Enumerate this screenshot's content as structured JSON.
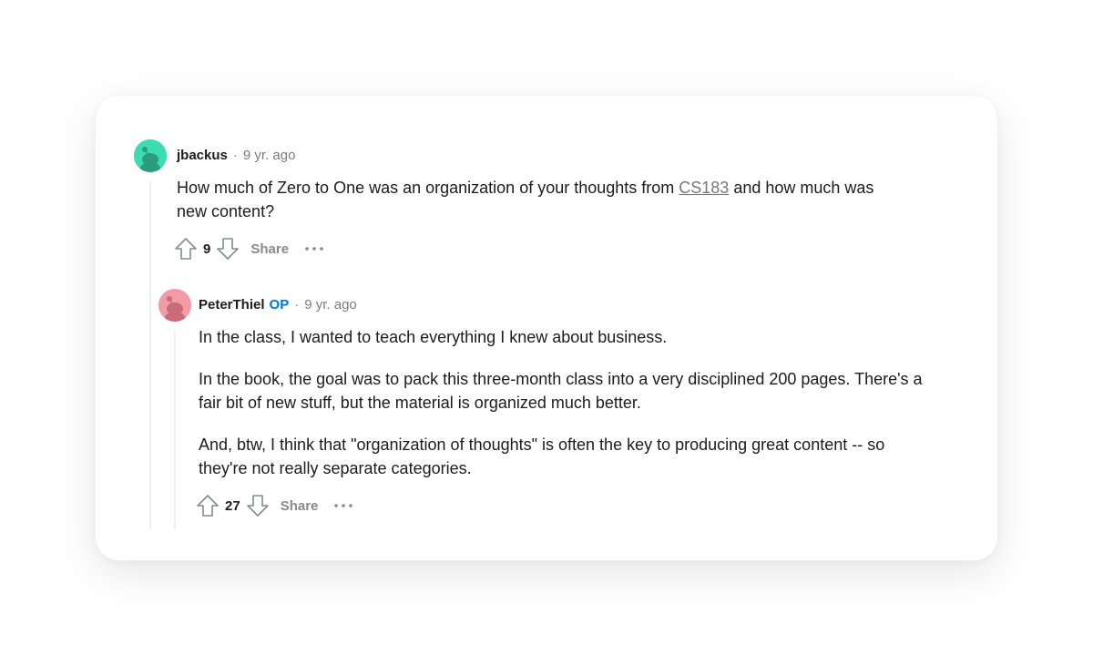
{
  "comments": [
    {
      "username": "jbackus",
      "separator": "·",
      "time": "9 yr. ago",
      "avatar_color": "#3ddbb2",
      "body_parts": {
        "before_link": "How much of Zero to One was an organization of your thoughts from ",
        "link_text": "CS183",
        "after_link": " and how much was new content?"
      },
      "score": "9",
      "share_label": "Share"
    },
    {
      "username": "PeterThiel",
      "op_badge": "OP",
      "separator": "·",
      "time": "9 yr. ago",
      "avatar_color": "#f49ca6",
      "paragraphs": [
        "In the class, I wanted to teach everything I knew about business.",
        "In the book, the goal was to pack this three-month class into a very disciplined 200 pages. There's a fair bit of new stuff, but the material is organized much better.",
        "And, btw, I think that \"organization of thoughts\" is often the key to producing great content -- so they're not really separate categories."
      ],
      "score": "27",
      "share_label": "Share"
    }
  ],
  "icons": {
    "upvote": "upvote-arrow-icon",
    "downvote": "downvote-arrow-icon",
    "more": "more-dots-icon",
    "avatar": "snoo-avatar-icon"
  },
  "colors": {
    "op_badge": "#0079d3",
    "meta_gray": "#7c7c7c",
    "thread_line": "#edeff1"
  }
}
